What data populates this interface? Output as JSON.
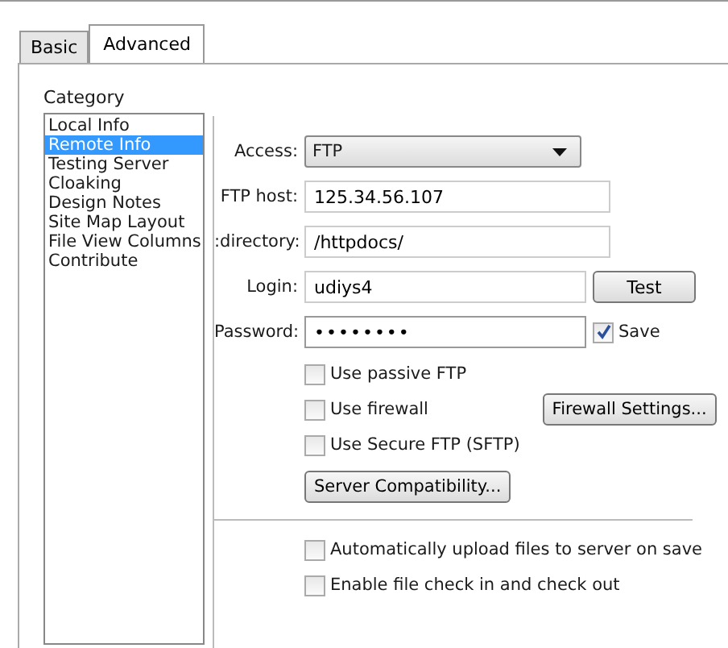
{
  "tabs": [
    {
      "label": "Basic",
      "selected": false
    },
    {
      "label": "Advanced",
      "selected": true
    }
  ],
  "category": {
    "label": "Category",
    "items": [
      {
        "label": "Local Info",
        "selected": false
      },
      {
        "label": "Remote Info",
        "selected": true
      },
      {
        "label": "Testing Server",
        "selected": false
      },
      {
        "label": "Cloaking",
        "selected": false
      },
      {
        "label": "Design Notes",
        "selected": false
      },
      {
        "label": "Site Map Layout",
        "selected": false
      },
      {
        "label": "File View Columns",
        "selected": false
      },
      {
        "label": "Contribute",
        "selected": false
      }
    ]
  },
  "access": {
    "label": "Access:",
    "value": "FTP"
  },
  "ftp_host": {
    "label": "FTP host:",
    "value": "125.34.56.107"
  },
  "directory": {
    "label": ":directory:",
    "value": "/httpdocs/"
  },
  "login": {
    "label": "Login:",
    "value": "udiys4"
  },
  "test_button": "Test",
  "password": {
    "label": "Password:",
    "value": "••••••••"
  },
  "save": {
    "label": "Save",
    "checked": true
  },
  "options": [
    {
      "label": "Use passive FTP",
      "checked": false
    },
    {
      "label": "Use firewall",
      "checked": false
    },
    {
      "label": "Use Secure FTP (SFTP)",
      "checked": false
    }
  ],
  "firewall_button": "Firewall Settings...",
  "compat_button": "Server Compatibility...",
  "bottom_options": [
    {
      "label": "Automatically upload files to server on save",
      "checked": false
    },
    {
      "label": "Enable file check in and check out",
      "checked": false
    }
  ]
}
